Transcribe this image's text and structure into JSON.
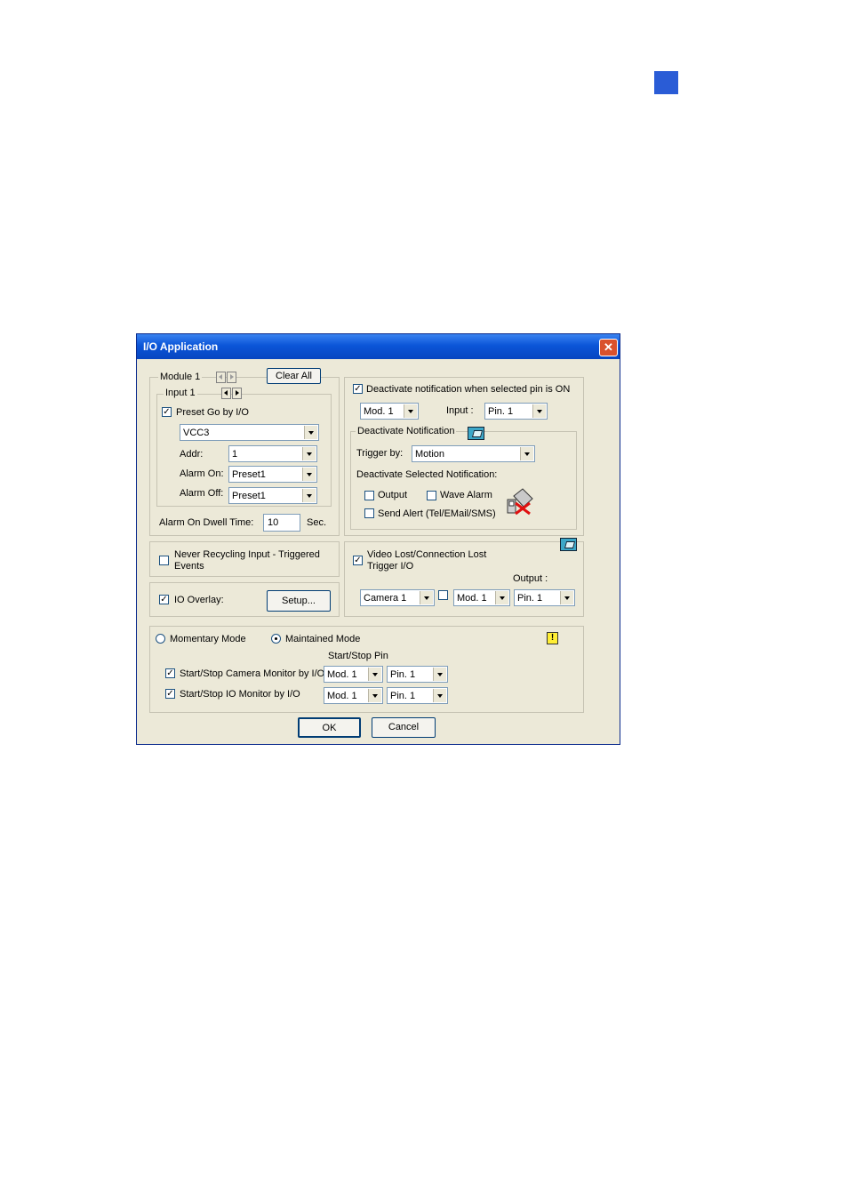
{
  "colors": {
    "page_marker": "#2a5cd6",
    "title_bar": "#0b55d8",
    "dialog_bg": "#ece9d8"
  },
  "dialog": {
    "title": "I/O Application",
    "close_icon": "close-icon"
  },
  "module": {
    "legend": "Module 1",
    "clear_all": "Clear All",
    "input_legend": "Input 1",
    "preset_go": {
      "label": "Preset Go by I/O",
      "checked": true
    },
    "device": "VCC3",
    "addr_label": "Addr:",
    "addr_value": "1",
    "alarm_on_label": "Alarm On:",
    "alarm_on_value": "Preset1",
    "alarm_off_label": "Alarm Off:",
    "alarm_off_value": "Preset1",
    "dwell_label": "Alarm On Dwell Time:",
    "dwell_value": "10",
    "dwell_unit": "Sec."
  },
  "deactivate": {
    "checkbox_label": "Deactivate notification when selected pin is ON",
    "checked": true,
    "mod_value": "Mod. 1",
    "input_label": "Input :",
    "pin_value": "Pin. 1",
    "group_legend": "Deactivate Notification",
    "trigger_label": "Trigger by:",
    "trigger_value": "Motion",
    "selected_label": "Deactivate Selected Notification:",
    "output_label": "Output",
    "wave_label": "Wave Alarm",
    "alert_label": "Send Alert (Tel/EMail/SMS)"
  },
  "never_recycling": {
    "label_line1": "Never Recycling Input - Triggered",
    "label_line2": "Events",
    "checked": false
  },
  "video_lost": {
    "label_line1": "Video Lost/Connection Lost",
    "label_line2": "Trigger I/O",
    "checked": true,
    "output_label": "Output :",
    "camera_value": "Camera 1",
    "mod_value": "Mod. 1",
    "pin_value": "Pin. 1"
  },
  "io_overlay": {
    "label": "IO Overlay:",
    "checked": true,
    "setup": "Setup..."
  },
  "mode": {
    "momentary": "Momentary Mode",
    "maintained": "Maintained Mode",
    "selected": "maintained",
    "pin_header": "Start/Stop Pin",
    "camera_monitor": {
      "label": "Start/Stop Camera Monitor by I/O",
      "checked": true,
      "mod": "Mod. 1",
      "pin": "Pin. 1"
    },
    "io_monitor": {
      "label": "Start/Stop IO Monitor by I/O",
      "checked": true,
      "mod": "Mod. 1",
      "pin": "Pin. 1"
    }
  },
  "buttons": {
    "ok": "OK",
    "cancel": "Cancel"
  }
}
